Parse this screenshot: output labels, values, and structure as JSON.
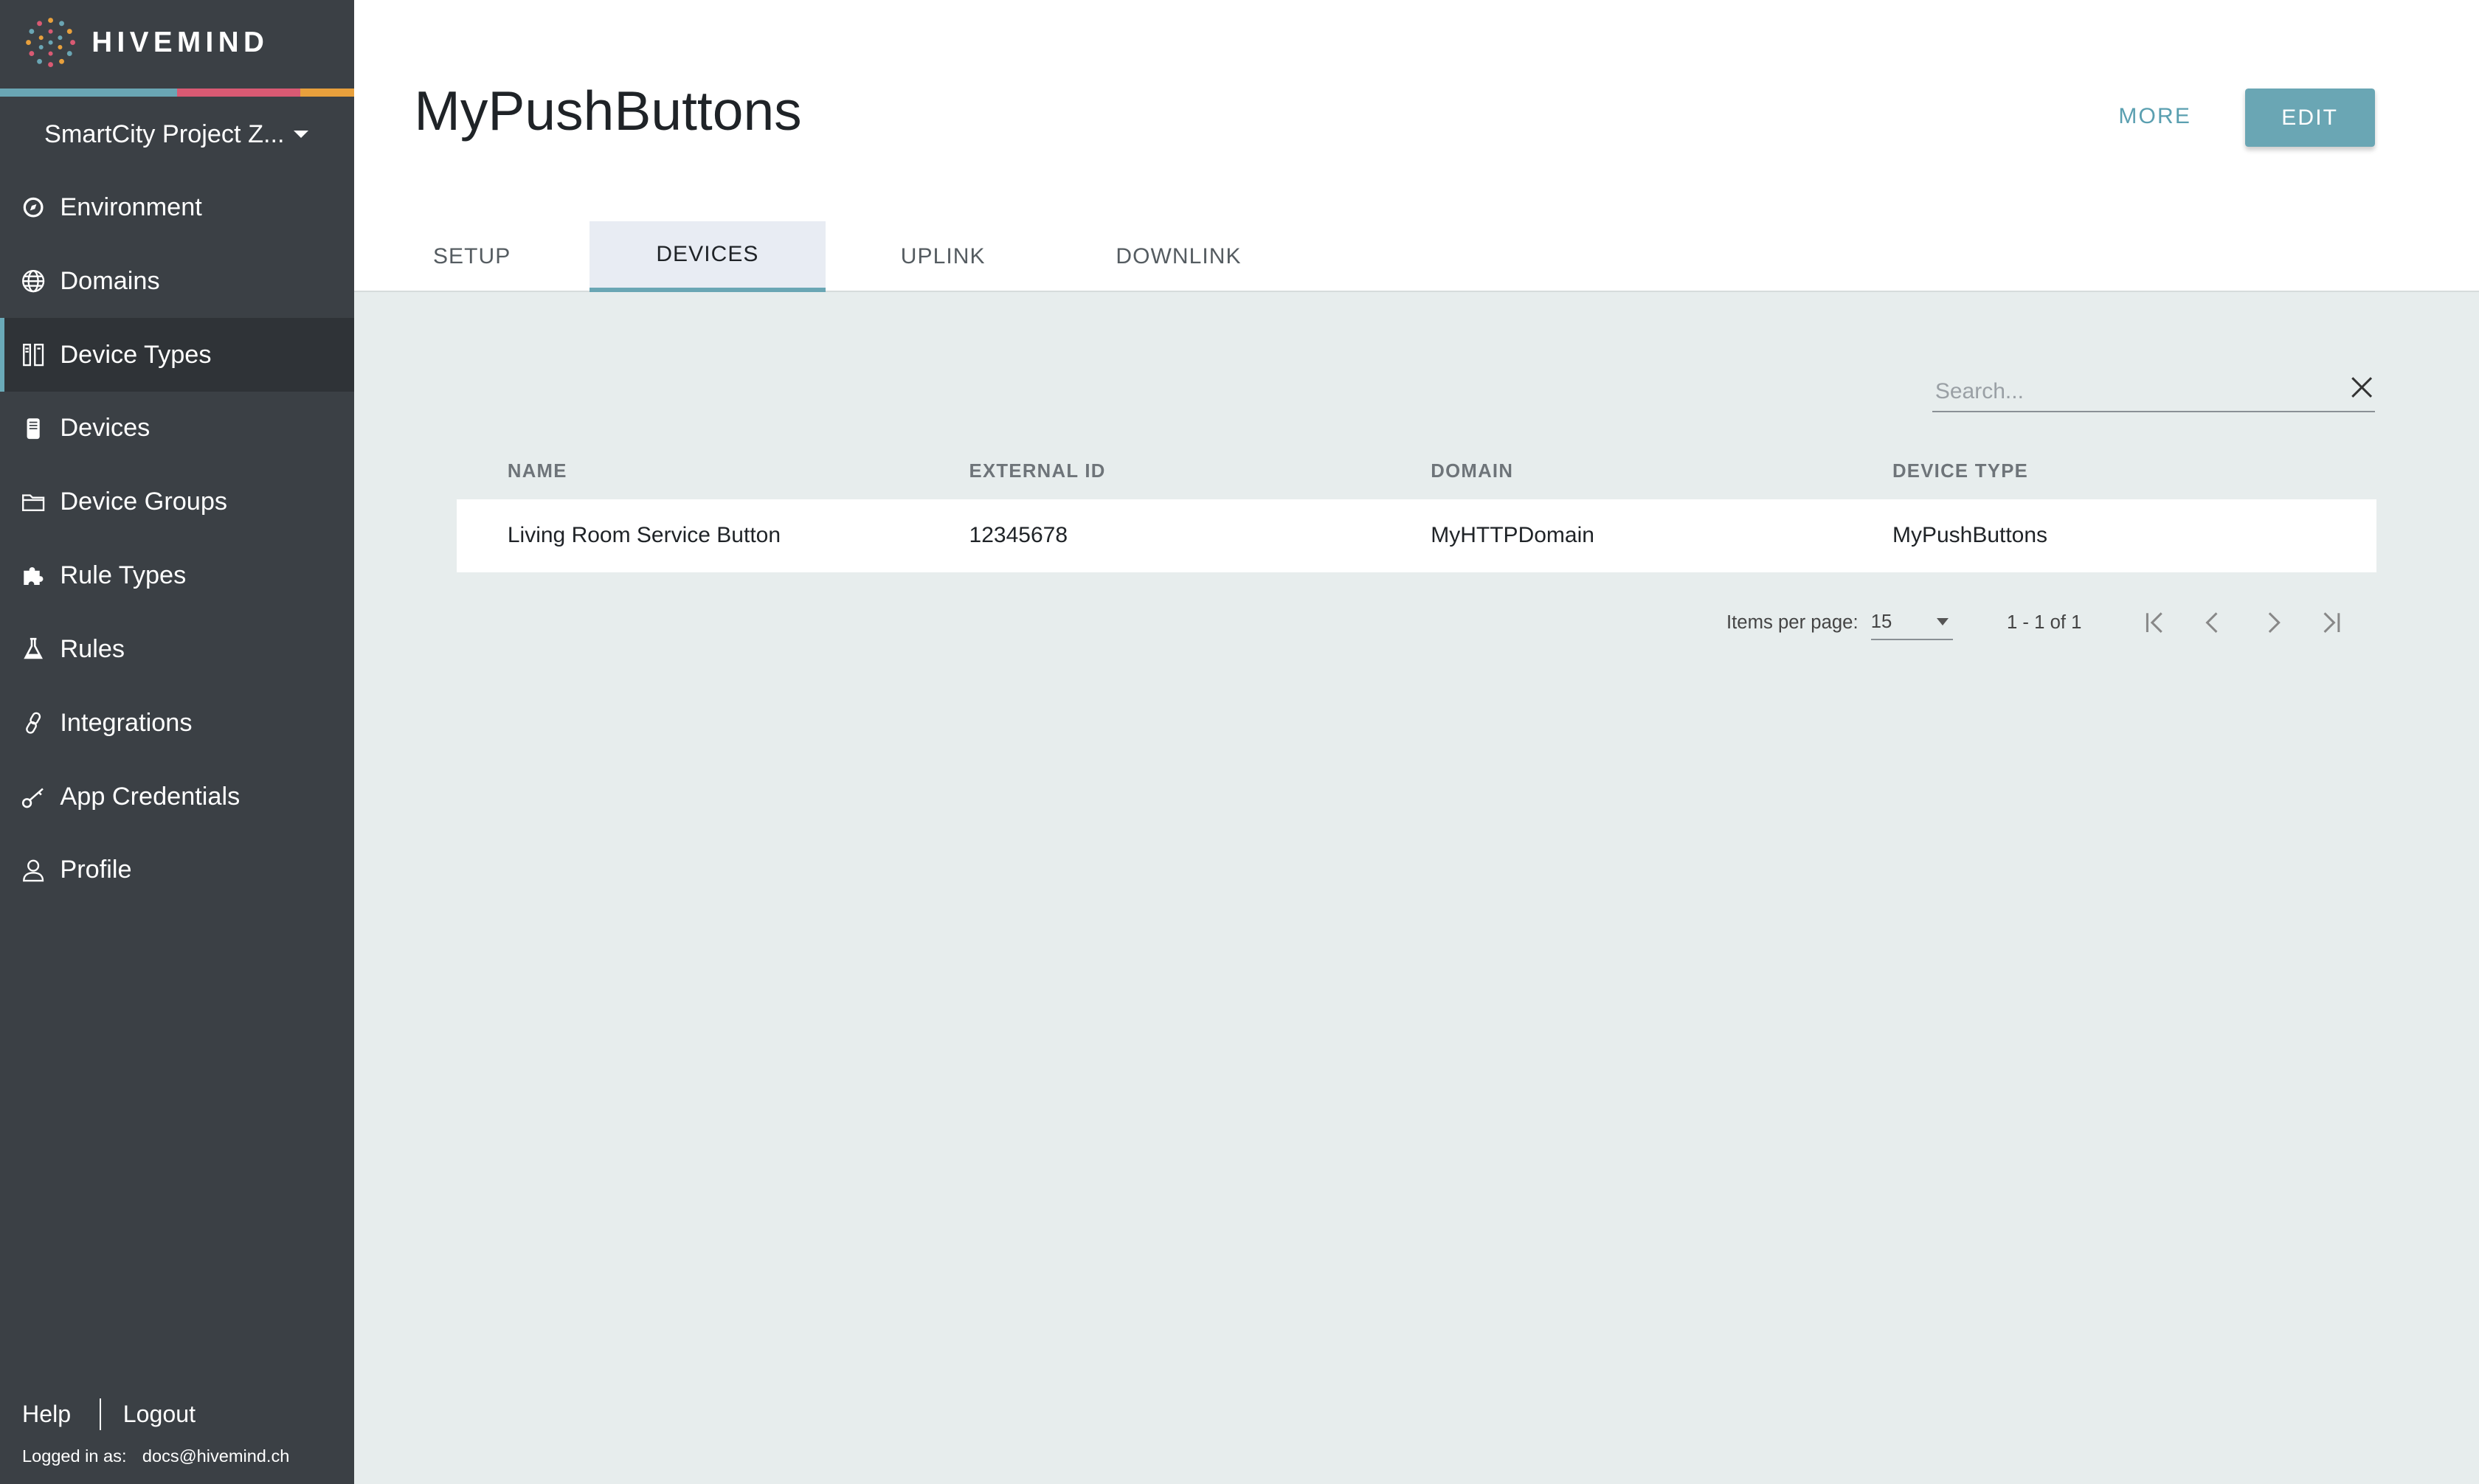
{
  "app": {
    "logo_text": "HIVEMIND",
    "stripe_colors": [
      "#6aa6b4",
      "#d95a73",
      "#e8a03c"
    ],
    "accent": "#6aa6b4"
  },
  "sidebar": {
    "project": "SmartCity Project Z...",
    "items": [
      {
        "label": "Environment",
        "icon": "environment-icon"
      },
      {
        "label": "Domains",
        "icon": "globe-icon"
      },
      {
        "label": "Device Types",
        "icon": "device-types-icon",
        "active": true
      },
      {
        "label": "Devices",
        "icon": "device-icon"
      },
      {
        "label": "Device Groups",
        "icon": "folder-icon"
      },
      {
        "label": "Rule Types",
        "icon": "puzzle-icon"
      },
      {
        "label": "Rules",
        "icon": "flask-icon"
      },
      {
        "label": "Integrations",
        "icon": "link-icon"
      },
      {
        "label": "App Credentials",
        "icon": "key-icon"
      },
      {
        "label": "Profile",
        "icon": "user-icon"
      }
    ],
    "footer": {
      "help": "Help",
      "logout": "Logout",
      "logged_in_label": "Logged in as:",
      "user_email": "docs@hivemind.ch"
    }
  },
  "header": {
    "title": "MyPushButtons",
    "more_label": "MORE",
    "edit_label": "EDIT",
    "tabs": [
      {
        "label": "SETUP"
      },
      {
        "label": "DEVICES",
        "active": true
      },
      {
        "label": "UPLINK"
      },
      {
        "label": "DOWNLINK"
      }
    ]
  },
  "search": {
    "placeholder": "Search...",
    "value": ""
  },
  "table": {
    "columns": [
      "NAME",
      "EXTERNAL ID",
      "DOMAIN",
      "DEVICE TYPE"
    ],
    "rows": [
      [
        "Living Room Service Button",
        "12345678",
        "MyHTTPDomain",
        "MyPushButtons"
      ]
    ]
  },
  "paginator": {
    "items_per_page_label": "Items per page:",
    "items_per_page": "15",
    "range": "1 - 1 of 1"
  }
}
